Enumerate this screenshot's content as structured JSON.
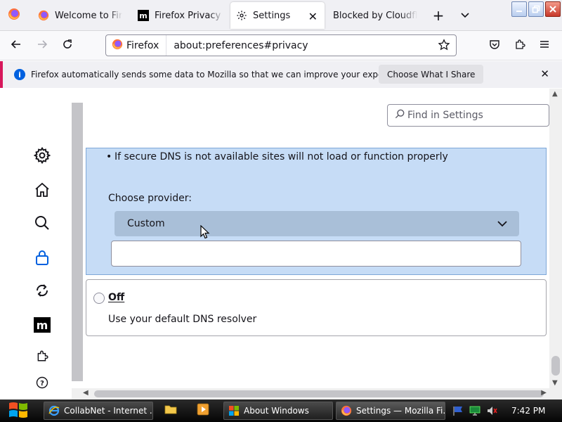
{
  "browser": {
    "tabs": [
      {
        "title": "Welcome to Firefox",
        "icon": "firefox-icon"
      },
      {
        "title": "Firefox Privacy Notice",
        "icon": "mozilla-icon"
      },
      {
        "title": "Settings",
        "icon": "gear-icon",
        "active": true
      },
      {
        "title": "Blocked by Cloudflare",
        "icon": ""
      }
    ],
    "new_tab_symbol": "+",
    "tab_close_symbol": "✕",
    "window_buttons": [
      "minimize",
      "restore",
      "close"
    ]
  },
  "navbar": {
    "identity_label": "Firefox",
    "url": "about:preferences#privacy"
  },
  "notification": {
    "message": "Firefox automatically sends some data to Mozilla so that we can improve your experience.",
    "button_label": "Choose What I Share",
    "info_symbol": "i",
    "close_symbol": "✕"
  },
  "settings": {
    "search_placeholder": "Find in Settings",
    "sidebar_icons": [
      "gear-icon",
      "home-icon",
      "search-icon",
      "lock-icon",
      "sync-icon",
      "mozilla-icon",
      "extension-icon",
      "help-icon"
    ],
    "doh": {
      "bullet": "If secure DNS is not available sites will not load or function properly",
      "choose_provider_label": "Choose provider:",
      "provider_selected": "Custom",
      "custom_value": ""
    },
    "off_option": {
      "label": "Off",
      "description": "Use your default DNS resolver"
    }
  },
  "taskbar": {
    "tasks": [
      {
        "label": "CollabNet - Internet ...",
        "icon": "ie-icon"
      },
      {
        "label": "About Windows",
        "icon": "windows-icon"
      },
      {
        "label": "Settings — Mozilla Fi...",
        "icon": "firefox-icon",
        "active": true
      }
    ],
    "clock": "7:42 PM"
  },
  "colors": {
    "accent": "#0060df",
    "doh_card_bg": "#c6dcf6",
    "notification_stripe": "#d7175b"
  }
}
